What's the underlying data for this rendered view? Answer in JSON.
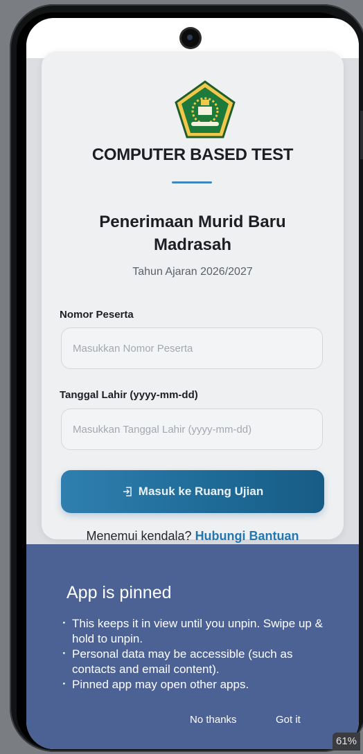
{
  "header": {
    "title": "COMPUTER BASED TEST",
    "subtitle": "Penerimaan Murid Baru Madrasah",
    "academic_year": "Tahun Ajaran 2026/2027"
  },
  "form": {
    "nomor_label": "Nomor Peserta",
    "nomor_placeholder": "Masukkan Nomor Peserta",
    "tgl_label": "Tanggal Lahir (yyyy-mm-dd)",
    "tgl_placeholder": "Masukkan Tanggal Lahir (yyyy-mm-dd)",
    "submit_label": "Masuk ke Ruang Ujian",
    "submit_icon": "login-icon"
  },
  "help": {
    "prefix": "Menemui kendala? ",
    "link": "Hubungi Bantuan"
  },
  "pin_dialog": {
    "title": "App is pinned",
    "items": [
      "This keeps it in view until you unpin. Swipe up & hold to unpin.",
      "Personal data may be accessible (such as contacts and email content).",
      "Pinned app may open other apps."
    ],
    "decline_label": "No thanks",
    "accept_label": "Got it"
  },
  "status": {
    "battery": "61%"
  },
  "colors": {
    "accent": "#2f7fae",
    "link": "#2277b0",
    "dialog_bg": "#4c6295"
  }
}
